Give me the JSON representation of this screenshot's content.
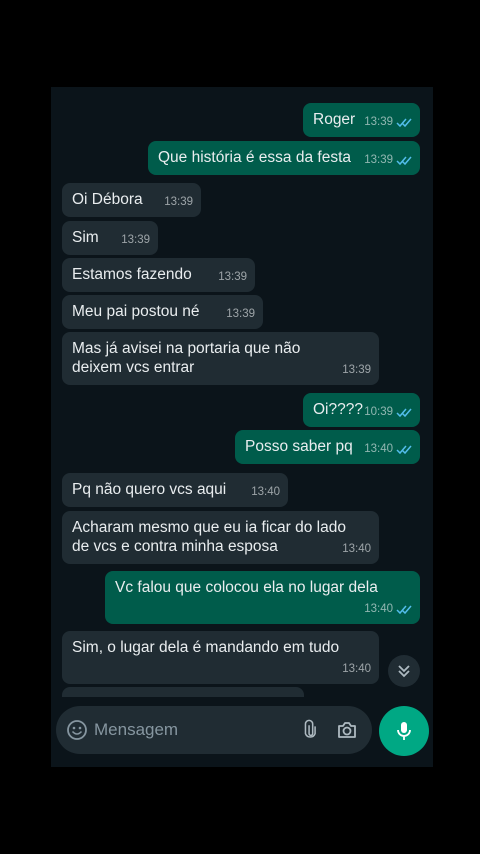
{
  "messages": [
    {
      "dir": "out",
      "text": "Roger",
      "time": "13:39",
      "ticks": true
    },
    {
      "dir": "out",
      "text": "Que história é essa da festa",
      "time": "13:39",
      "ticks": true
    },
    {
      "dir": "in",
      "text": "Oi Débora",
      "time": "13:39"
    },
    {
      "dir": "in",
      "text": "Sim",
      "time": "13:39"
    },
    {
      "dir": "in",
      "text": "Estamos fazendo",
      "time": "13:39"
    },
    {
      "dir": "in",
      "text": "Meu pai postou né",
      "time": "13:39"
    },
    {
      "dir": "in",
      "text": "Mas já avisei na portaria que não deixem vcs entrar",
      "time": "13:39"
    },
    {
      "dir": "out",
      "text": "Oi????",
      "time": "10:39",
      "ticks": true
    },
    {
      "dir": "out",
      "text": "Posso saber pq",
      "time": "13:40",
      "ticks": true
    },
    {
      "dir": "in",
      "text": "Pq não quero vcs aqui",
      "time": "13:40"
    },
    {
      "dir": "in",
      "text": "Acharam mesmo que eu ia ficar do lado de vcs e contra minha esposa",
      "time": "13:40"
    },
    {
      "dir": "out",
      "text": "Vc falou que colocou ela no lugar dela",
      "time": "13:40",
      "ticks": true
    },
    {
      "dir": "in",
      "text": "Sim, o lugar dela é mandando em tudo",
      "time": "13:40"
    }
  ],
  "composer": {
    "placeholder": "Mensagem"
  },
  "colors": {
    "incoming": "#202c33",
    "outgoing": "#005c4b",
    "accent": "#00a884",
    "ticks": "#53bdeb",
    "background": "#0b141a"
  },
  "icons": {
    "emoji": "emoji-icon",
    "attach": "paperclip-icon",
    "camera": "camera-icon",
    "mic": "mic-icon",
    "scroll": "double-chevron-down-icon"
  }
}
